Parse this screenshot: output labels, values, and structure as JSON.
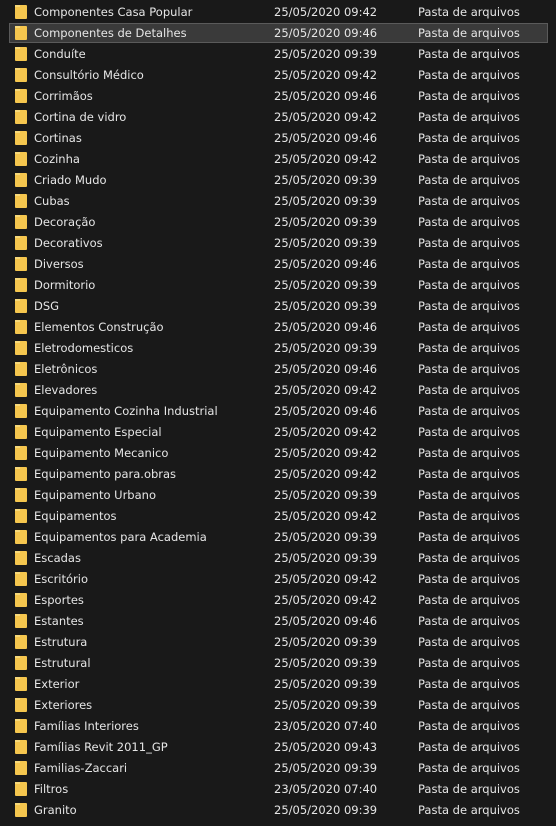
{
  "files": [
    {
      "name": "Componentes Casa Popular",
      "date": "25/05/2020 09:42",
      "type": "Pasta de arquivos",
      "selected": false
    },
    {
      "name": "Componentes de Detalhes",
      "date": "25/05/2020 09:46",
      "type": "Pasta de arquivos",
      "selected": true
    },
    {
      "name": "Conduíte",
      "date": "25/05/2020 09:39",
      "type": "Pasta de arquivos",
      "selected": false
    },
    {
      "name": "Consultório Médico",
      "date": "25/05/2020 09:42",
      "type": "Pasta de arquivos",
      "selected": false
    },
    {
      "name": "Corrimãos",
      "date": "25/05/2020 09:46",
      "type": "Pasta de arquivos",
      "selected": false
    },
    {
      "name": "Cortina de vidro",
      "date": "25/05/2020 09:42",
      "type": "Pasta de arquivos",
      "selected": false
    },
    {
      "name": "Cortinas",
      "date": "25/05/2020 09:46",
      "type": "Pasta de arquivos",
      "selected": false
    },
    {
      "name": "Cozinha",
      "date": "25/05/2020 09:42",
      "type": "Pasta de arquivos",
      "selected": false
    },
    {
      "name": "Criado Mudo",
      "date": "25/05/2020 09:39",
      "type": "Pasta de arquivos",
      "selected": false
    },
    {
      "name": "Cubas",
      "date": "25/05/2020 09:39",
      "type": "Pasta de arquivos",
      "selected": false
    },
    {
      "name": "Decoração",
      "date": "25/05/2020 09:39",
      "type": "Pasta de arquivos",
      "selected": false
    },
    {
      "name": "Decorativos",
      "date": "25/05/2020 09:39",
      "type": "Pasta de arquivos",
      "selected": false
    },
    {
      "name": "Diversos",
      "date": "25/05/2020 09:46",
      "type": "Pasta de arquivos",
      "selected": false
    },
    {
      "name": "Dormitorio",
      "date": "25/05/2020 09:39",
      "type": "Pasta de arquivos",
      "selected": false
    },
    {
      "name": "DSG",
      "date": "25/05/2020 09:39",
      "type": "Pasta de arquivos",
      "selected": false
    },
    {
      "name": "Elementos Construção",
      "date": "25/05/2020 09:46",
      "type": "Pasta de arquivos",
      "selected": false
    },
    {
      "name": "Eletrodomesticos",
      "date": "25/05/2020 09:39",
      "type": "Pasta de arquivos",
      "selected": false
    },
    {
      "name": "Eletrônicos",
      "date": "25/05/2020 09:46",
      "type": "Pasta de arquivos",
      "selected": false
    },
    {
      "name": "Elevadores",
      "date": "25/05/2020 09:42",
      "type": "Pasta de arquivos",
      "selected": false
    },
    {
      "name": "Equipamento Cozinha Industrial",
      "date": "25/05/2020 09:46",
      "type": "Pasta de arquivos",
      "selected": false
    },
    {
      "name": "Equipamento Especial",
      "date": "25/05/2020 09:42",
      "type": "Pasta de arquivos",
      "selected": false
    },
    {
      "name": "Equipamento Mecanico",
      "date": "25/05/2020 09:42",
      "type": "Pasta de arquivos",
      "selected": false
    },
    {
      "name": "Equipamento para.obras",
      "date": "25/05/2020 09:42",
      "type": "Pasta de arquivos",
      "selected": false
    },
    {
      "name": "Equipamento Urbano",
      "date": "25/05/2020 09:39",
      "type": "Pasta de arquivos",
      "selected": false
    },
    {
      "name": "Equipamentos",
      "date": "25/05/2020 09:42",
      "type": "Pasta de arquivos",
      "selected": false
    },
    {
      "name": "Equipamentos para Academia",
      "date": "25/05/2020 09:39",
      "type": "Pasta de arquivos",
      "selected": false
    },
    {
      "name": "Escadas",
      "date": "25/05/2020 09:39",
      "type": "Pasta de arquivos",
      "selected": false
    },
    {
      "name": "Escritório",
      "date": "25/05/2020 09:42",
      "type": "Pasta de arquivos",
      "selected": false
    },
    {
      "name": "Esportes",
      "date": "25/05/2020 09:42",
      "type": "Pasta de arquivos",
      "selected": false
    },
    {
      "name": "Estantes",
      "date": "25/05/2020 09:46",
      "type": "Pasta de arquivos",
      "selected": false
    },
    {
      "name": "Estrutura",
      "date": "25/05/2020 09:39",
      "type": "Pasta de arquivos",
      "selected": false
    },
    {
      "name": "Estrutural",
      "date": "25/05/2020 09:39",
      "type": "Pasta de arquivos",
      "selected": false
    },
    {
      "name": "Exterior",
      "date": "25/05/2020 09:39",
      "type": "Pasta de arquivos",
      "selected": false
    },
    {
      "name": "Exteriores",
      "date": "25/05/2020 09:39",
      "type": "Pasta de arquivos",
      "selected": false
    },
    {
      "name": "Famílias Interiores",
      "date": "23/05/2020 07:40",
      "type": "Pasta de arquivos",
      "selected": false
    },
    {
      "name": "Famílias Revit 2011_GP",
      "date": "25/05/2020 09:43",
      "type": "Pasta de arquivos",
      "selected": false
    },
    {
      "name": "Familias-Zaccari",
      "date": "25/05/2020 09:39",
      "type": "Pasta de arquivos",
      "selected": false
    },
    {
      "name": "Filtros",
      "date": "23/05/2020 07:40",
      "type": "Pasta de arquivos",
      "selected": false
    },
    {
      "name": "Granito",
      "date": "25/05/2020 09:39",
      "type": "Pasta de arquivos",
      "selected": false
    }
  ],
  "icon": "folder-icon",
  "colors": {
    "background": "#191919",
    "text": "#e6e6e6",
    "folder": "#f5c64e",
    "selection": "#3a3a3a"
  }
}
